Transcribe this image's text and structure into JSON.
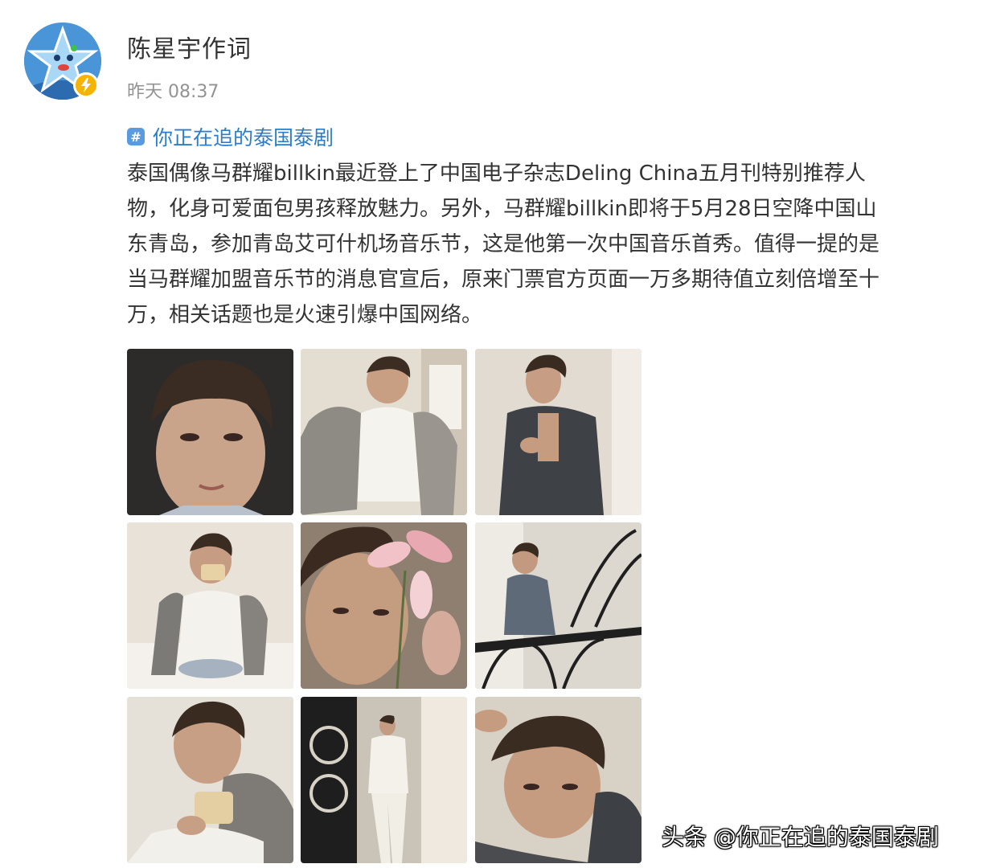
{
  "post": {
    "author_name": "陈星宇作词",
    "timestamp": "昨天 08:37",
    "topic_icon": "#",
    "topic": "你正在追的泰国泰剧",
    "body_lines": [
      "泰国偶像马群耀billkin最近登上了中国电子杂志Deling China五月刊特别推荐人",
      "物，化身可爱面包男孩释放魅力。另外，马群耀billkin即将于5月28日空降中国山",
      "东青岛，参加青岛艾可什机场音乐节，这是他第一次中国音乐首秀。值得一提的是",
      "当马群耀加盟音乐节的消息官宣后，原来门票官方页面一万多期待值立刻倍增至十",
      "万，相关话题也是火速引爆中国网络。"
    ]
  },
  "photos": [
    {
      "name": "portrait-closeup"
    },
    {
      "name": "sitting-white-tank"
    },
    {
      "name": "denim-vest"
    },
    {
      "name": "eating-bread"
    },
    {
      "name": "pink-flower"
    },
    {
      "name": "staircase"
    },
    {
      "name": "holding-toast"
    },
    {
      "name": "white-suit-doorway"
    },
    {
      "name": "lying-hand-in-hair"
    }
  ],
  "watermark": "头条 @你正在追的泰国泰剧",
  "colors": {
    "link_blue": "#2a7ec9",
    "text_dark": "#333333",
    "text_muted": "#939393",
    "badge_yellow": "#f5b400"
  }
}
